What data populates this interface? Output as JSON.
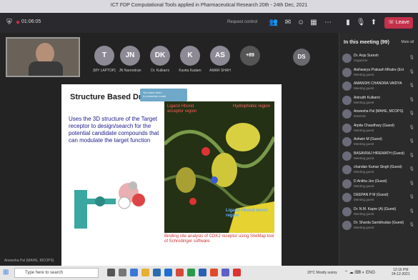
{
  "window": {
    "title": "ICT FDP Computational Tools applied in Pharmaceutical Research 20th - 24th Dec, 2021"
  },
  "toolbar": {
    "timer": "01:06:05",
    "request_control": "Request control",
    "leave_label": "Leave"
  },
  "stage": {
    "self_name": "",
    "footer": "Anwesha Pal (MAHE, MCOPS)"
  },
  "avatars": [
    {
      "initials": "T",
      "name": "[MY LAPTOP]"
    },
    {
      "initials": "JN",
      "name": "JN Narendran"
    },
    {
      "initials": "DK",
      "name": "Dr. Kulkarni"
    },
    {
      "initials": "K",
      "name": "Kavita Kadam"
    },
    {
      "initials": "AS",
      "name": "AMAR SHAH"
    },
    {
      "initials": "+89",
      "name": ""
    }
  ],
  "ds_avatar": "DS",
  "slide": {
    "title": "Structure Based Drug Design",
    "toast_line1": "You have been",
    "toast_line2": "in presenter mode",
    "body": "Uses the 3D structure of the Target receptor to design/search for the potential candidate compounds that can modulate the target function",
    "label_acceptor": "Ligand Hbond acceptor region",
    "label_hydrophobic": "Hydrophobic region",
    "label_donor": "Ligand Hbond donor region",
    "caption": "Binding site analysis of CDK2 receptor using SiteMap tool of Schrodinger software"
  },
  "panel": {
    "title": "In this meeting (99)",
    "mute_all": "Mute all",
    "participants": [
      {
        "name": "Dr. Anju Suresh",
        "role": "Organizer"
      },
      {
        "name": "Aishwarya Prakash Mhatre (Ext",
        "role": "Meeting guest"
      },
      {
        "name": "AMANSHI CHANDRA VAIDYA",
        "role": "Meeting guest"
      },
      {
        "name": "Anirudh Kulkarni",
        "role": "Meeting guest"
      },
      {
        "name": "Anwesha Pal (MAHE, MCOPS)",
        "role": "External"
      },
      {
        "name": "Arpita Chaudhary (Guest)",
        "role": "Meeting guest"
      },
      {
        "name": "Ashwin M (Guest)",
        "role": "Meeting guest"
      },
      {
        "name": "BASAVRAJ HIREMATH (Guest)",
        "role": "Meeting guest"
      },
      {
        "name": "chandan Kumar Singh (Guest)",
        "role": "Meeting guest"
      },
      {
        "name": "D Anitha Jeo (Guest)",
        "role": "Meeting guest"
      },
      {
        "name": "DEEPAN P M (Guest)",
        "role": "Meeting guest"
      },
      {
        "name": "Dr. N.M. Kapre (A) (Guest)",
        "role": "Meeting guest"
      },
      {
        "name": "Dr. Sharda Sambhudas (Guest)",
        "role": "Meeting guest"
      }
    ]
  },
  "taskbar": {
    "search_placeholder": "Type here to search",
    "weather": "20°C Mostly sunny",
    "clock_time": "12:16 PM",
    "clock_date": "24-12-2021"
  },
  "colors": {
    "leave": "#c4314b",
    "slide_body": "#1a1a8c",
    "caption": "#c33333"
  }
}
